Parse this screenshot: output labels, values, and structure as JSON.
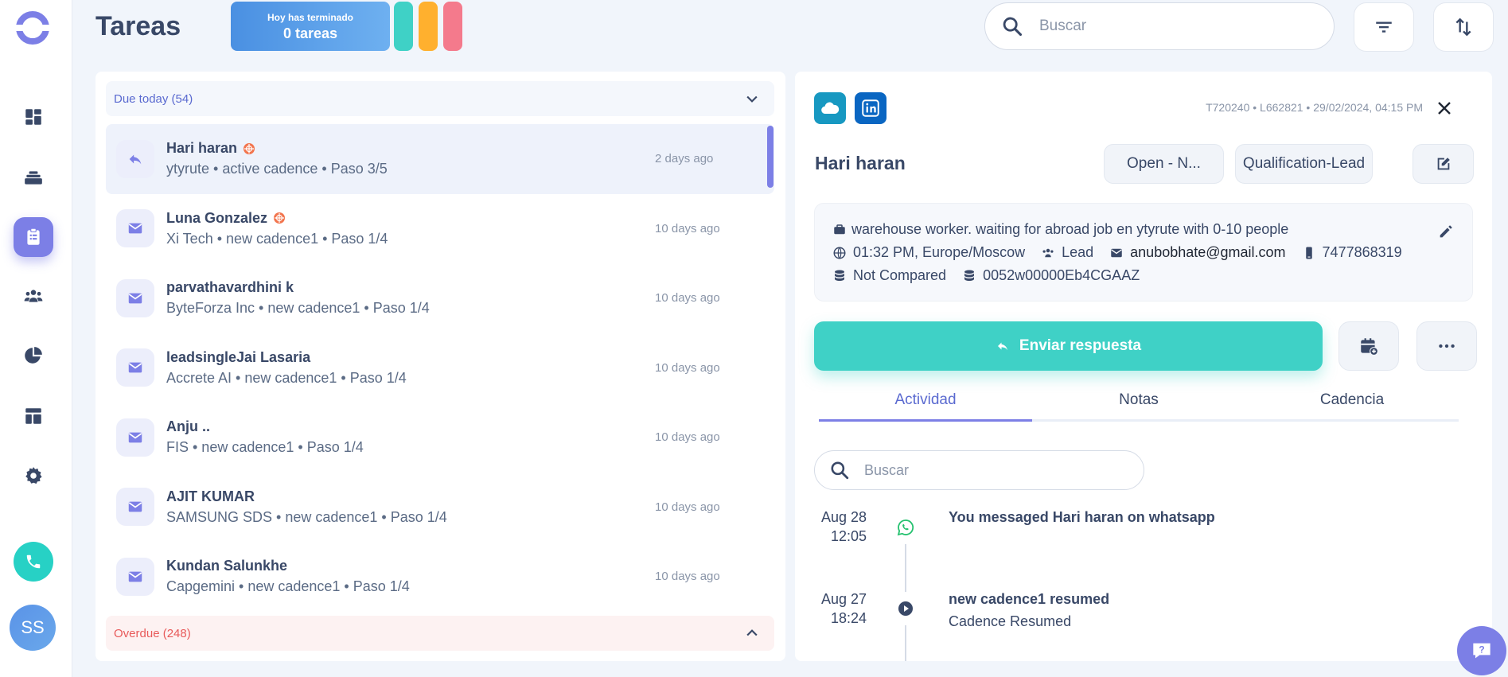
{
  "header": {
    "title": "Tareas",
    "summary_line1": "Hoy has terminado",
    "summary_line2": "0 tareas",
    "search_placeholder": "Buscar",
    "colors": {
      "pill_teal": "#3fd1c6",
      "pill_orange": "#ffb02e",
      "pill_pink": "#f47a8c"
    }
  },
  "sidebar": {
    "items": [
      "dashboard-icon",
      "layers-icon",
      "tasks-icon",
      "people-icon",
      "pie-chart-icon",
      "layout-icon",
      "gear-icon"
    ],
    "active": "tasks-icon",
    "avatar_initials": "SS"
  },
  "groups": {
    "due_label": "Due today (54)",
    "overdue_label": "Overdue (248)"
  },
  "tasks": [
    {
      "name": "Hari haran",
      "sub": "ytyrute • active cadence • Paso 3/5",
      "time": "2 days ago",
      "icon": "reply-icon",
      "badge": true
    },
    {
      "name": "Luna Gonzalez",
      "sub": "Xi Tech • new cadence1 • Paso 1/4",
      "time": "10 days ago",
      "icon": "mail-icon",
      "badge": true
    },
    {
      "name": "parvathavardhini k",
      "sub": "ByteForza Inc • new cadence1 • Paso 1/4",
      "time": "10 days ago",
      "icon": "mail-icon",
      "badge": false
    },
    {
      "name": "leadsingleJai Lasaria",
      "sub": "Accrete AI • new cadence1 • Paso 1/4",
      "time": "10 days ago",
      "icon": "mail-icon",
      "badge": false
    },
    {
      "name": "Anju ..",
      "sub": "FIS • new cadence1 • Paso 1/4",
      "time": "10 days ago",
      "icon": "mail-icon",
      "badge": false
    },
    {
      "name": "AJIT KUMAR",
      "sub": "SAMSUNG SDS • new cadence1 • Paso 1/4",
      "time": "10 days ago",
      "icon": "mail-icon",
      "badge": false
    },
    {
      "name": "Kundan Salunkhe",
      "sub": "Capgemini • new cadence1 • Paso 1/4",
      "time": "10 days ago",
      "icon": "mail-icon",
      "badge": false
    }
  ],
  "detail": {
    "meta": "T720240 • L662821 • 29/02/2024, 04:15 PM",
    "lead_name": "Hari haran",
    "status_tag": "Open - N...",
    "type_tag": "Qualification-Lead",
    "info_job": "warehouse worker. waiting for abroad job en ytyrute with 0-10 people",
    "info_time": "01:32 PM, Europe/Moscow",
    "info_role": "Lead",
    "info_email": "anubobhate@gmail.com",
    "info_phone": "7477868319",
    "info_compare": "Not Compared",
    "info_crm_id": "0052w00000Eb4CGAAZ",
    "send_label": "Enviar respuesta",
    "tabs": [
      "Actividad",
      "Notas",
      "Cadencia"
    ],
    "activity_search_placeholder": "Buscar",
    "activities": [
      {
        "date": "Aug 28",
        "time": "12:05",
        "title": "You messaged Hari haran on whatsapp",
        "sub": "",
        "icon": "whatsapp-icon"
      },
      {
        "date": "Aug 27",
        "time": "18:24",
        "title": "new cadence1 resumed",
        "sub": "Cadence Resumed",
        "icon": "play-icon"
      }
    ]
  }
}
